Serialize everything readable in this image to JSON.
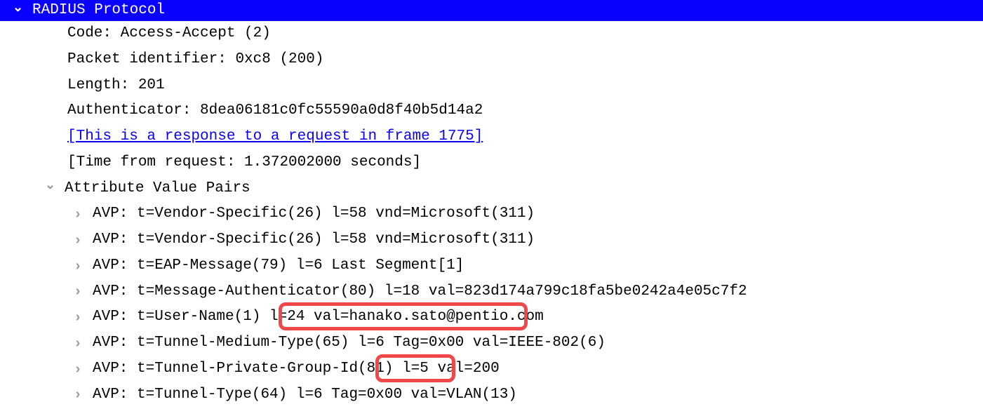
{
  "header": {
    "title": "RADIUS Protocol"
  },
  "fields": {
    "code": "Code: Access-Accept (2)",
    "packet_id": "Packet identifier: 0xc8 (200)",
    "length": "Length: 201",
    "authenticator": "Authenticator: 8dea06181c0fc55590a0d8f40b5d14a2",
    "response_link": "[This is a response to a request in frame 1775]",
    "time": "[Time from request: 1.372002000 seconds]"
  },
  "avp_header": "Attribute Value Pairs",
  "avps": [
    "AVP: t=Vendor-Specific(26) l=58 vnd=Microsoft(311)",
    "AVP: t=Vendor-Specific(26) l=58 vnd=Microsoft(311)",
    "AVP: t=EAP-Message(79) l=6 Last Segment[1]",
    "AVP: t=Message-Authenticator(80) l=18 val=823d174a799c18fa5be0242a4e05c7f2",
    "AVP: t=User-Name(1) l=24 val=hanako.sato@pentio.com",
    "AVP: t=Tunnel-Medium-Type(65) l=6 Tag=0x00 val=IEEE-802(6)",
    "AVP: t=Tunnel-Private-Group-Id(81) l=5 val=200",
    "AVP: t=Tunnel-Type(64) l=6 Tag=0x00 val=VLAN(13)"
  ],
  "highlights": {
    "username_val": "val=hanako.sato@pentio.com",
    "group_val": "val=200"
  }
}
